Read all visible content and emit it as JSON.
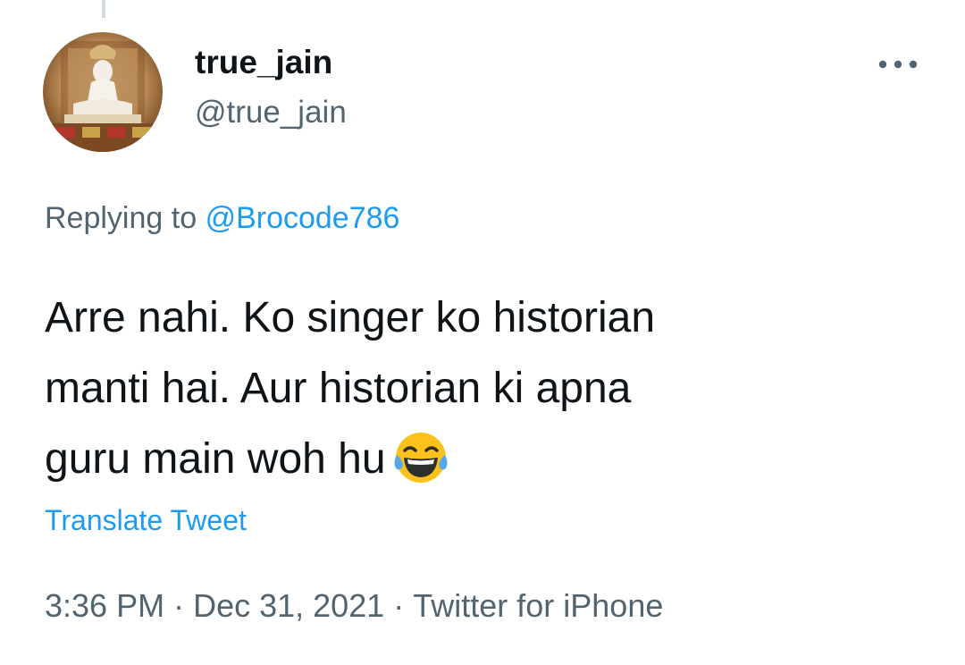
{
  "tweet": {
    "author": {
      "display_name": "true_jain",
      "handle": "@true_jain",
      "avatar_icon": "statue-avatar"
    },
    "more_icon": "more-horizontal-icon",
    "replying": {
      "prefix": "Replying to",
      "mention": "@Brocode786"
    },
    "text_lines": [
      "Arre nahi. Ko singer ko historian",
      "manti hai.  Aur historian ki apna",
      "guru main woh hu"
    ],
    "emoji": "face-with-tears-of-joy-emoji",
    "translate_label": "Translate Tweet",
    "meta": {
      "time": "3:36 PM",
      "separator": "·",
      "date": "Dec 31, 2021",
      "source": "Twitter for iPhone"
    },
    "colors": {
      "text": "#0f1419",
      "secondary": "#536471",
      "link": "#1d9bf0"
    }
  }
}
